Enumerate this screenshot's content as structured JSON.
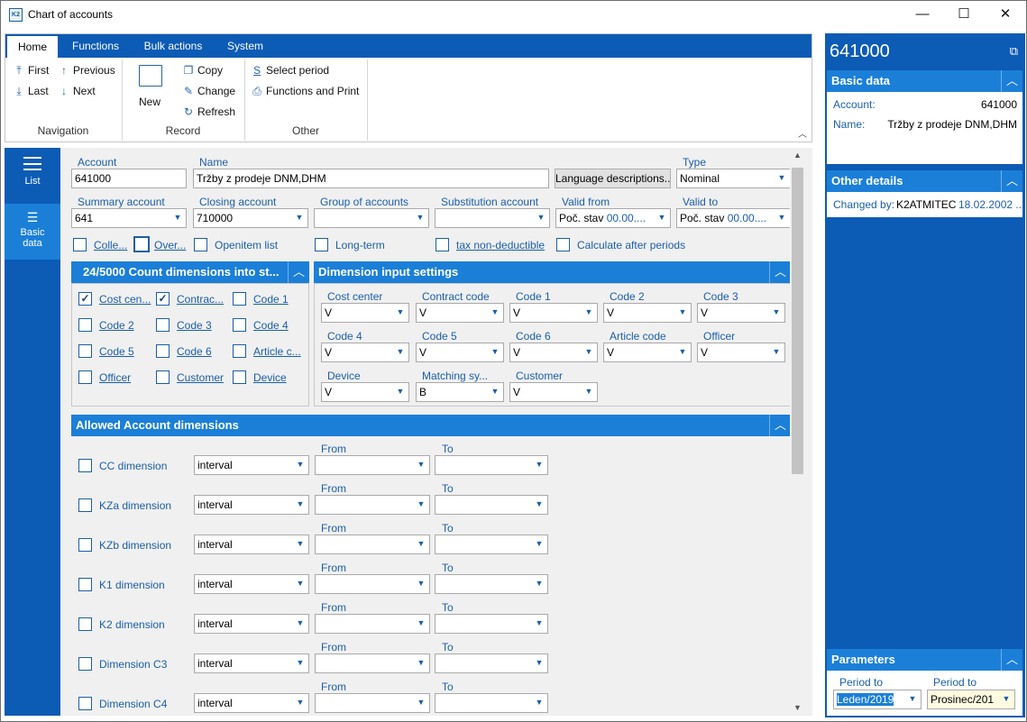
{
  "window": {
    "title": "Chart of accounts",
    "min": "—",
    "max": "☐",
    "close": "✕",
    "app_icon": "K2"
  },
  "ribbon": {
    "tabs": [
      "Home",
      "Functions",
      "Bulk actions",
      "System"
    ],
    "navigation": {
      "first": "First",
      "previous": "Previous",
      "last": "Last",
      "next": "Next",
      "group": "Navigation"
    },
    "record": {
      "new": "New",
      "copy": "Copy",
      "change": "Change",
      "refresh": "Refresh",
      "group": "Record"
    },
    "other": {
      "select_period": "Select period",
      "functions_print": "Functions and Print",
      "group": "Other"
    }
  },
  "leftnav": {
    "list": "List",
    "basic_data_1": "Basic",
    "basic_data_2": "data"
  },
  "form": {
    "account_label": "Account",
    "account_value": "641000",
    "name_label": "Name",
    "name_value": "Tržby z prodeje DNM,DHM",
    "language_btn": "Language descriptions...",
    "type_label": "Type",
    "type_value": "Nominal",
    "summary_label": "Summary account",
    "summary_value": "641",
    "closing_label": "Closing account",
    "closing_value": "710000",
    "group_label": "Group of accounts",
    "group_value": "",
    "subst_label": "Substitution account",
    "subst_value": "",
    "valid_from_label": "Valid from",
    "valid_from_prefix": "Poč. stav",
    "valid_from_value": "00.00....",
    "valid_to_label": "Valid to",
    "valid_to_prefix": "Poč. stav",
    "valid_to_value": "00.00....",
    "checks": [
      {
        "label": "Colle...",
        "checked": false
      },
      {
        "label": "Over...",
        "checked": false
      },
      {
        "label": "Openitem list",
        "checked": false
      },
      {
        "label": "Long-term",
        "checked": false
      },
      {
        "label": "tax non-deductible",
        "checked": false
      },
      {
        "label": "Calculate after periods",
        "checked": false
      }
    ]
  },
  "count_dims": {
    "title": "24/5000 Count dimensions into st...",
    "items": [
      {
        "label": "Cost cen...",
        "checked": true
      },
      {
        "label": "Contrac...",
        "checked": true
      },
      {
        "label": "Code 1",
        "checked": false
      },
      {
        "label": "Code 2",
        "checked": false
      },
      {
        "label": "Code 3",
        "checked": false
      },
      {
        "label": "Code 4",
        "checked": false
      },
      {
        "label": "Code 5",
        "checked": false
      },
      {
        "label": "Code 6",
        "checked": false
      },
      {
        "label": "Article c...",
        "checked": false
      },
      {
        "label": "Officer",
        "checked": false
      },
      {
        "label": "Customer",
        "checked": false
      },
      {
        "label": "Device",
        "checked": false
      }
    ]
  },
  "dim_input": {
    "title": "Dimension input settings",
    "items": [
      {
        "label": "Cost center",
        "value": "V"
      },
      {
        "label": "Contract code",
        "value": "V"
      },
      {
        "label": "Code 1",
        "value": "V"
      },
      {
        "label": "Code 2",
        "value": "V"
      },
      {
        "label": "Code 3",
        "value": "V"
      },
      {
        "label": "Code 4",
        "value": "V"
      },
      {
        "label": "Code 5",
        "value": "V"
      },
      {
        "label": "Code 6",
        "value": "V"
      },
      {
        "label": "Article code",
        "value": "V"
      },
      {
        "label": "Officer",
        "value": "V"
      },
      {
        "label": "Device",
        "value": "V"
      },
      {
        "label": "Matching sy...",
        "value": "B"
      },
      {
        "label": "Customer",
        "value": "V"
      }
    ]
  },
  "allowed": {
    "title": "Allowed Account dimensions",
    "from_label": "From",
    "to_label": "To",
    "rows": [
      {
        "label": "CC dimension",
        "mode": "interval",
        "from": "",
        "to": ""
      },
      {
        "label": "KZa dimension",
        "mode": "interval",
        "from": "",
        "to": ""
      },
      {
        "label": "KZb dimension",
        "mode": "interval",
        "from": "",
        "to": ""
      },
      {
        "label": "K1 dimension",
        "mode": "interval",
        "from": "",
        "to": ""
      },
      {
        "label": "K2 dimension",
        "mode": "interval",
        "from": "",
        "to": ""
      },
      {
        "label": "Dimension C3",
        "mode": "interval",
        "from": "",
        "to": ""
      },
      {
        "label": "Dimension C4",
        "mode": "interval",
        "from": "",
        "to": ""
      }
    ]
  },
  "right": {
    "account": "641000",
    "basic_title": "Basic data",
    "account_label": "Account:",
    "account_value": "641000",
    "name_label": "Name:",
    "name_value": "Tržby z prodeje DNM,DHM",
    "other_title": "Other details",
    "changed_label": "Changed by:",
    "changed_user": "K2ATMITEC",
    "changed_date": "18.02.2002 ...",
    "params_title": "Parameters",
    "period_to_label_1": "Period to",
    "period_to_value_1": "Leden/2019",
    "period_to_label_2": "Period to",
    "period_to_value_2": "Prosinec/201"
  },
  "colors": {
    "brand": "#0c5bb5",
    "header": "#1b7fd8",
    "label": "#1b5ea8"
  }
}
